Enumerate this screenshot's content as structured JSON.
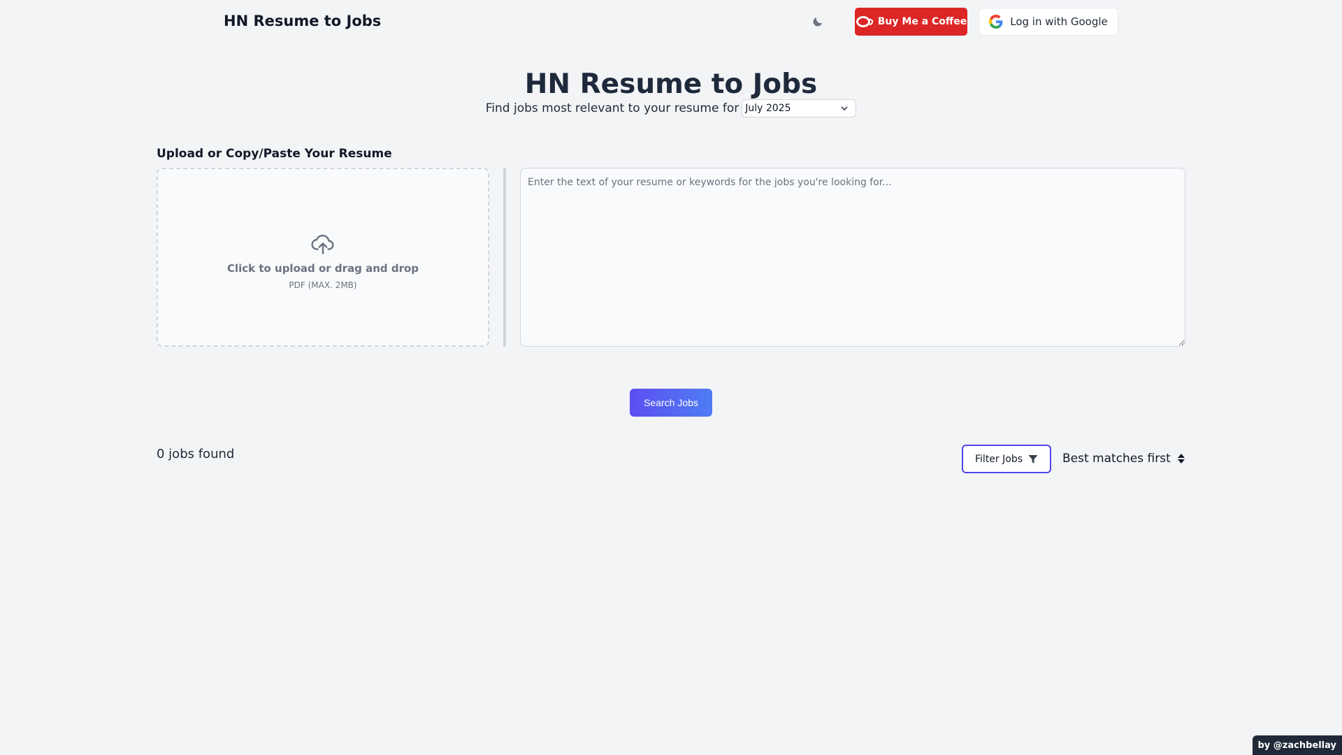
{
  "header": {
    "brand": "HN Resume to Jobs",
    "theme_toggle_icon": "moon-icon",
    "coffee_label": "Buy Me a Coffee",
    "coffee_icon": "coffee-cup-icon",
    "google_label": "Log in with Google",
    "google_icon": "google-logo-icon"
  },
  "hero": {
    "title": "HN Resume to Jobs",
    "subtitle": "Find jobs most relevant to your resume for",
    "month_selected": "July 2025"
  },
  "upload": {
    "section_label": "Upload or Copy/Paste Your Resume",
    "dropzone_title": "Click to upload or drag and drop",
    "dropzone_hint": "PDF (MAX. 2MB)",
    "textarea_placeholder": "Enter the text of your resume or keywords for the jobs you're looking for...",
    "textarea_value": ""
  },
  "actions": {
    "search_label": "Search Jobs"
  },
  "results": {
    "count_text": "0 jobs found",
    "filter_label": "Filter Jobs",
    "sort_selected": "Best matches first"
  },
  "footer": {
    "credit": "by @zachbellay"
  },
  "colors": {
    "background": "#f3f4f6",
    "coffee_red": "#dc2626",
    "primary_gradient_start": "#5b4ef0",
    "primary_gradient_end": "#4f7df5",
    "filter_border": "#4f46e5"
  }
}
